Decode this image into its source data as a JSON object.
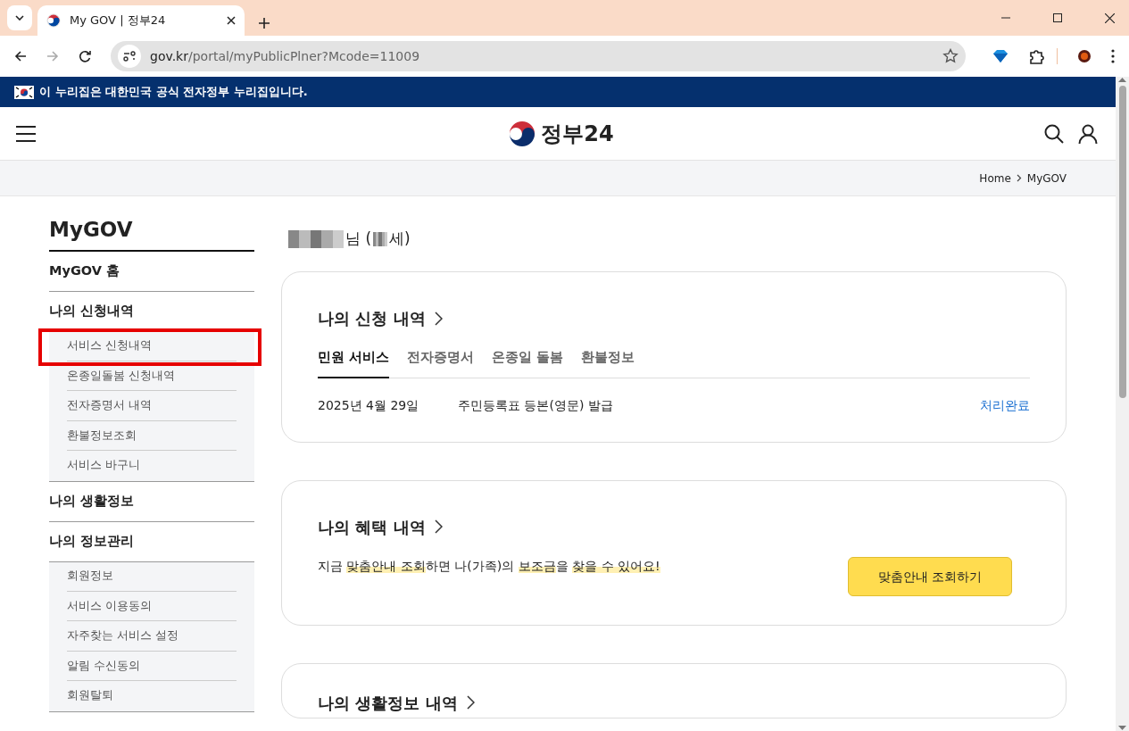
{
  "browser": {
    "tab_title": "My GOV | 정부24",
    "url_host": "gov.kr",
    "url_path": "/portal/myPublicPlner?Mcode=11009",
    "forward_disabled": true
  },
  "gov_banner": "이 누리집은 대한민국 공식 전자정부 누리집입니다.",
  "header": {
    "logo_text": "정부24"
  },
  "breadcrumb": [
    "Home",
    "MyGOV"
  ],
  "sidebar": {
    "title": "MyGOV",
    "items": [
      {
        "label": "MyGOV 홈"
      },
      {
        "label": "나의 신청내역",
        "children": [
          {
            "label": "서비스 신청내역",
            "annotated": true
          },
          {
            "label": "온종일돌봄 신청내역",
            "annotated": false
          },
          {
            "label": "전자증명서 내역",
            "annotated": false
          },
          {
            "label": "환불정보조회",
            "annotated": false
          },
          {
            "label": "서비스 바구니",
            "annotated": false
          }
        ]
      },
      {
        "label": "나의 생활정보"
      },
      {
        "label": "나의 정보관리",
        "children": [
          {
            "label": "회원정보",
            "annotated": false
          },
          {
            "label": "서비스 이용동의",
            "annotated": false
          },
          {
            "label": "자주찾는 서비스 설정",
            "annotated": false
          },
          {
            "label": "알림 수신동의",
            "annotated": false
          },
          {
            "label": "회원탈퇴",
            "annotated": false
          }
        ]
      }
    ]
  },
  "greeting": {
    "honorific": "님 (",
    "age_suffix": "세)"
  },
  "applications": {
    "title": "나의 신청 내역",
    "tabs": [
      {
        "label": "민원 서비스",
        "selected": true
      },
      {
        "label": "전자증명서",
        "selected": false
      },
      {
        "label": "온종일 돌봄",
        "selected": false
      },
      {
        "label": "환불정보",
        "selected": false
      }
    ],
    "rows": [
      {
        "date": "2025년 4월 29일",
        "service": "주민등록표 등본(영문) 발급",
        "status": "처리완료"
      }
    ]
  },
  "benefits": {
    "title": "나의 혜택 내역",
    "message": [
      {
        "text": "지금 ",
        "highlight": false
      },
      {
        "text": "맞춤안내 조회",
        "highlight": true
      },
      {
        "text": "하면 나(가족)의 ",
        "highlight": false
      },
      {
        "text": "보조금",
        "highlight": true
      },
      {
        "text": "을 ",
        "highlight": false
      },
      {
        "text": "찾을 수 있어요!",
        "highlight": true
      }
    ],
    "button": "맞춤안내 조회하기"
  },
  "living_info": {
    "title": "나의 생활정보 내역"
  }
}
